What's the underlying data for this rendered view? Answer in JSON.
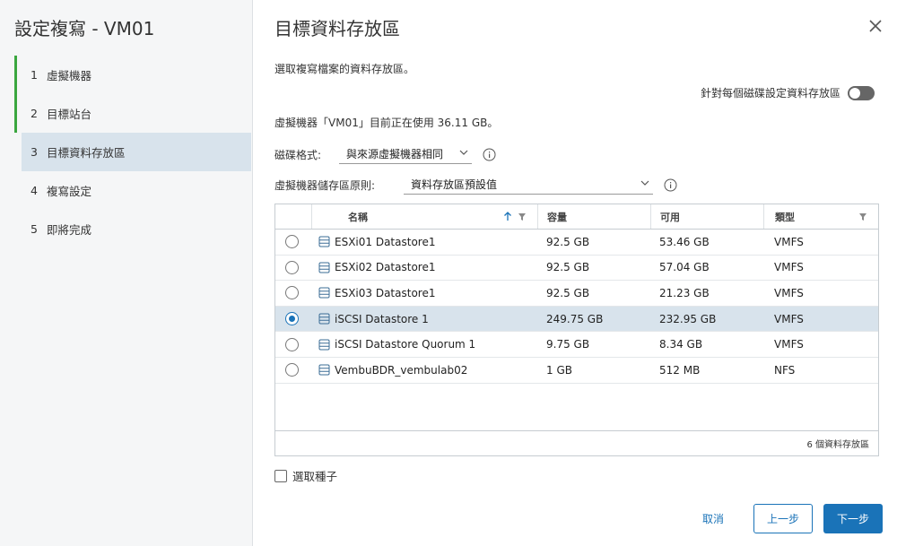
{
  "wizard": {
    "title": "設定複寫 - VM01",
    "steps": [
      {
        "num": "1",
        "label": "虛擬機器",
        "state": "done"
      },
      {
        "num": "2",
        "label": "目標站台",
        "state": "done"
      },
      {
        "num": "3",
        "label": "目標資料存放區",
        "state": "active"
      },
      {
        "num": "4",
        "label": "複寫設定",
        "state": "pending"
      },
      {
        "num": "5",
        "label": "即將完成",
        "state": "pending"
      }
    ]
  },
  "page": {
    "title": "目標資料存放區",
    "instruction": "選取複寫檔案的資料存放區。",
    "toggle_label": "針對每個磁碟設定資料存放區",
    "toggle_on": false,
    "usage_text": "虛擬機器「VM01」目前正在使用 36.11 GB。",
    "disk_format_label": "磁碟格式:",
    "disk_format_value": "與來源虛擬機器相同",
    "storage_policy_label": "虛擬機器儲存區原則:",
    "storage_policy_value": "資料存放區預設值"
  },
  "table": {
    "columns": {
      "name": "名稱",
      "capacity": "容量",
      "free": "可用",
      "type": "類型"
    },
    "rows": [
      {
        "name": "ESXi01 Datastore1",
        "capacity": "92.5 GB",
        "free": "53.46 GB",
        "type": "VMFS",
        "selected": false
      },
      {
        "name": "ESXi02 Datastore1",
        "capacity": "92.5 GB",
        "free": "57.04 GB",
        "type": "VMFS",
        "selected": false
      },
      {
        "name": "ESXi03 Datastore1",
        "capacity": "92.5 GB",
        "free": "21.23 GB",
        "type": "VMFS",
        "selected": false
      },
      {
        "name": "iSCSI Datastore 1",
        "capacity": "249.75 GB",
        "free": "232.95 GB",
        "type": "VMFS",
        "selected": true
      },
      {
        "name": "iSCSI Datastore Quorum 1",
        "capacity": "9.75 GB",
        "free": "8.34 GB",
        "type": "VMFS",
        "selected": false
      },
      {
        "name": "VembuBDR_vembulab02",
        "capacity": "1 GB",
        "free": "512 MB",
        "type": "NFS",
        "selected": false
      }
    ],
    "footer": "6 個資料存放區"
  },
  "seed_label": "選取種子",
  "buttons": {
    "cancel": "取消",
    "back": "上一步",
    "next": "下一步"
  },
  "colors": {
    "accent": "#1a73b8",
    "done_bar": "#3aa63f",
    "selected_bg": "#d8e3ec"
  }
}
